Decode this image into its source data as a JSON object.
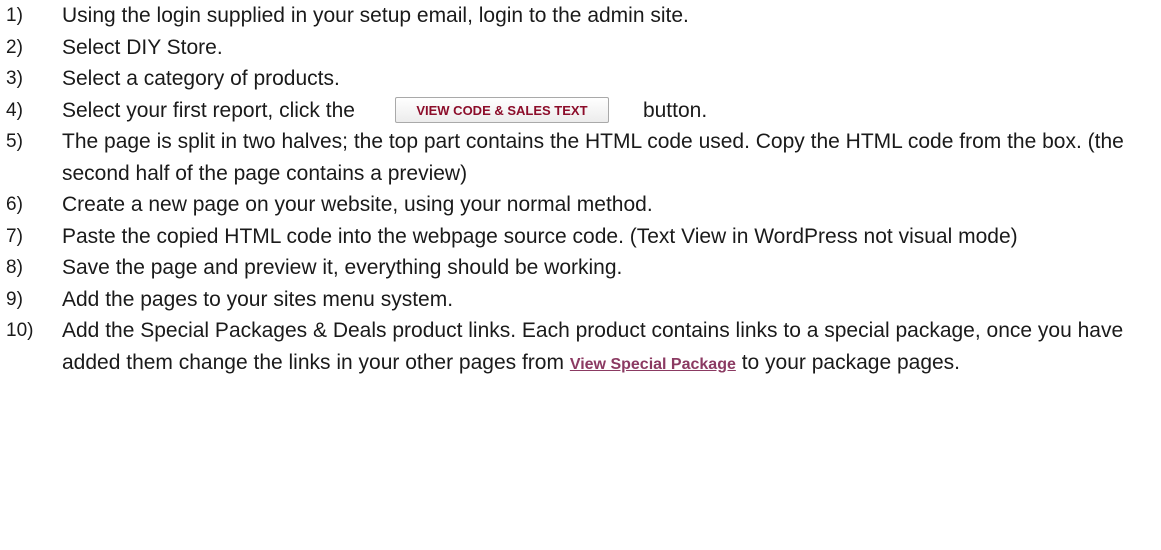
{
  "steps": [
    {
      "num": "1)",
      "text": "Using the login supplied in your setup email, login to the admin site."
    },
    {
      "num": "2)",
      "text": "Select DIY Store."
    },
    {
      "num": "3)",
      "text": "Select a category of products."
    },
    {
      "num": "4)",
      "text_before": "Select your first report, click the",
      "button_label": "VIEW CODE & SALES TEXT",
      "text_after": "button."
    },
    {
      "num": "5)",
      "text": "The page is split in two halves; the top part contains the HTML code used.  Copy the HTML code from the box. (the second half of the page contains a preview)"
    },
    {
      "num": "6)",
      "text": "Create a new page on your website, using your normal method."
    },
    {
      "num": "7)",
      "text": "Paste the copied HTML code into the webpage source code.   (Text View in WordPress not visual mode)"
    },
    {
      "num": "8)",
      "text": "Save the page and preview it, everything should be working."
    },
    {
      "num": "9)",
      "text": "Add the pages to your sites menu system."
    },
    {
      "num": "10)",
      "text_before": "Add the Special Packages & Deals product links.  Each product contains links to a special package, once you have added them change the links in your other pages from",
      "link_label": "View Special Package",
      "text_after": "to your package pages."
    }
  ],
  "colors": {
    "text": "#1a1a1a",
    "button_text": "#8c0d2a",
    "link": "#8b3a62"
  }
}
